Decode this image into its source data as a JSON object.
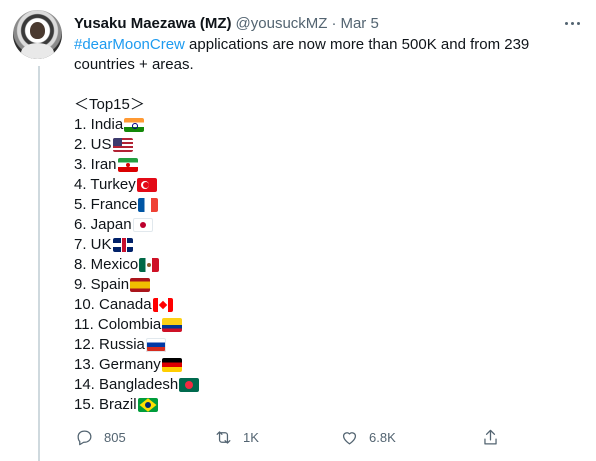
{
  "tweet": {
    "display_name": "Yusaku Maezawa (MZ)",
    "handle": "@yousuckMZ",
    "separator": "·",
    "date": "Mar 5",
    "hashtag": "#dearMoonCrew",
    "intro_rest": " applications are now more than 500K and from 239",
    "intro_line2": "countries + areas.",
    "list_heading": "＜Top15＞",
    "top15": [
      {
        "label": "1. India",
        "flag": "india"
      },
      {
        "label": "2. US",
        "flag": "us"
      },
      {
        "label": "3. Iran",
        "flag": "iran"
      },
      {
        "label": "4. Turkey",
        "flag": "turkey"
      },
      {
        "label": "5. France",
        "flag": "france"
      },
      {
        "label": "6. Japan",
        "flag": "japan"
      },
      {
        "label": "7. UK",
        "flag": "uk"
      },
      {
        "label": "8. Mexico",
        "flag": "mexico"
      },
      {
        "label": "9. Spain",
        "flag": "spain"
      },
      {
        "label": "10. Canada",
        "flag": "canada"
      },
      {
        "label": "11. Colombia",
        "flag": "colombia"
      },
      {
        "label": "12. Russia",
        "flag": "russia"
      },
      {
        "label": "13. Germany",
        "flag": "germany"
      },
      {
        "label": "14. Bangladesh",
        "flag": "bangladesh"
      },
      {
        "label": "15. Brazil",
        "flag": "brazil"
      }
    ]
  },
  "actions": {
    "reply_count": "805",
    "retweet_count": "1K",
    "like_count": "6.8K",
    "reply_icon": "reply-icon",
    "retweet_icon": "retweet-icon",
    "like_icon": "heart-icon",
    "share_icon": "share-icon"
  },
  "colors": {
    "link": "#1d9bf0",
    "secondary_text": "#536471",
    "primary_text": "#0f1419"
  }
}
